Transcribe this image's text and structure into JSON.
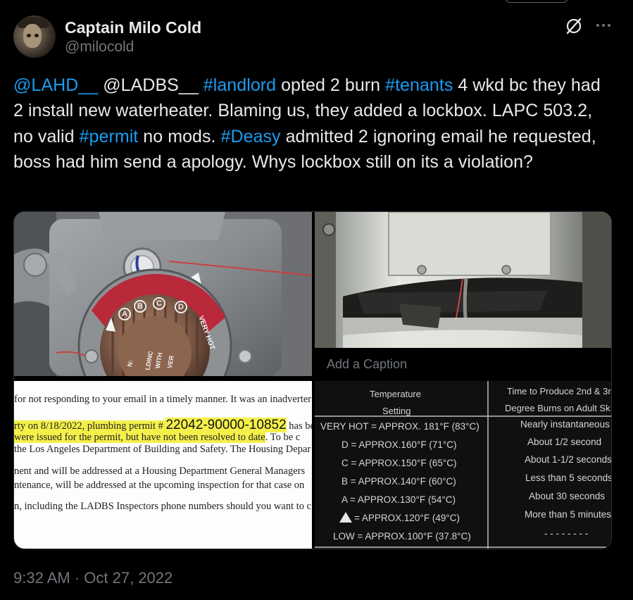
{
  "author": {
    "display_name": "Captain Milo Cold",
    "handle": "@milocold"
  },
  "icons": {
    "grok": "grok-icon",
    "more": "more-options-icon"
  },
  "tweet": {
    "segments": [
      {
        "text": "@LAHD__",
        "link": true
      },
      {
        "text": " @LADBS__ ",
        "link": false
      },
      {
        "text": "#landlord",
        "link": true
      },
      {
        "text": " opted 2 burn ",
        "link": false
      },
      {
        "text": "#tenants",
        "link": true
      },
      {
        "text": " 4 wkd bc they had 2 install new waterheater. Blaming us, they added a lockbox. LAPC 503.2, no valid ",
        "link": false
      },
      {
        "text": "#permit",
        "link": true
      },
      {
        "text": " no mods. ",
        "link": false
      },
      {
        "text": "#Deasy",
        "link": true
      },
      {
        "text": " admitted 2 ignoring email he requested, boss had him send a apology. Whys lockbox still on its a violation?",
        "link": false
      }
    ]
  },
  "media": {
    "caption_placeholder": "Add a Caption",
    "dial_labels": [
      "A",
      "B",
      "C",
      "D"
    ],
    "dial_very_hot": "VERY HOT",
    "dial_text": [
      "N:",
      "LDINC",
      "WITH",
      "VER"
    ],
    "document_lines": [
      {
        "pre": "for not responding to your email in a timely manner. It was an inadverter",
        "hl": "",
        "big": "",
        "post": ""
      },
      {
        "pre": "",
        "hl": "rty on 8/18/2022,  plumbing permit # ",
        "big": "22042-90000-10852",
        "post": "  has be"
      },
      {
        "pre": "",
        "hl": "were issued for the permit, but have not been resolved to date",
        "big": "",
        "post": ". To be c"
      },
      {
        "pre": "the Los Angeles Department of Building and Safety. The Housing Depar",
        "hl": "",
        "big": "",
        "post": ""
      },
      {
        "pre": "nent and will be addressed at a Housing Department General Managers",
        "hl": "",
        "big": "",
        "post": ""
      },
      {
        "pre": "ntenance, will be addressed at the upcoming inspection for that case on",
        "hl": "",
        "big": "",
        "post": ""
      },
      {
        "pre": "n, including the LADBS Inspectors phone numbers should you want to c",
        "hl": "",
        "big": "",
        "post": ""
      }
    ],
    "temp_table": {
      "col1_header": [
        "Temperature",
        "Setting"
      ],
      "col2_header": [
        "Time to Produce 2nd & 3r",
        "Degree Burns on Adult Sk"
      ],
      "rows": [
        {
          "setting": "VERY HOT =  APPROX. 181°F (83°C)",
          "time": "Nearly instantaneous"
        },
        {
          "setting": "D = APPROX.160°F (71°C)",
          "time": "About 1/2 second"
        },
        {
          "setting": "C = APPROX.150°F (65°C)",
          "time": "About 1-1/2 seconds"
        },
        {
          "setting": "B = APPROX.140°F (60°C)",
          "time": "Less than 5 seconds"
        },
        {
          "setting": "A = APPROX.130°F (54°C)",
          "time": "About 30 seconds"
        },
        {
          "setting": "= APPROX.120°F (49°C)",
          "time": "More than 5 minutes"
        },
        {
          "setting": "LOW = APPROX.100°F (37.8°C)",
          "time": "- - - - - - - -"
        }
      ]
    }
  },
  "timestamp": {
    "time": "9:32 AM",
    "separator": " · ",
    "date": "Oct 27, 2022"
  },
  "colors": {
    "background": "#000000",
    "text": "#e7e9ea",
    "secondary": "#71767b",
    "link": "#1d9bf0",
    "highlight": "#f4f04a"
  }
}
